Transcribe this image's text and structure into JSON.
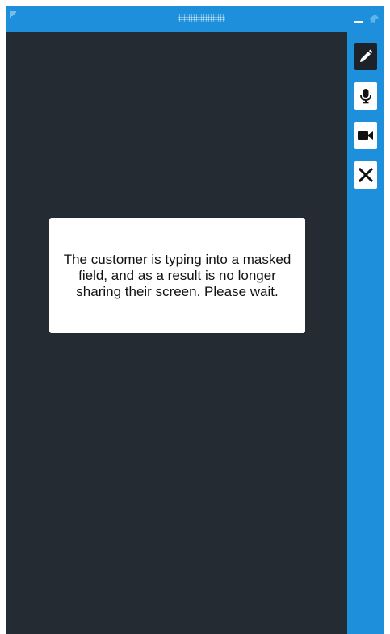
{
  "titlebar": {
    "controls": {
      "resize": "resize-grip-icon",
      "drag": "drag-grip-icon",
      "minimize": "minimize-icon",
      "pin": "pin-icon"
    }
  },
  "toolbar": {
    "buttons": [
      {
        "icon": "pencil-icon",
        "active": true
      },
      {
        "icon": "microphone-icon",
        "active": false
      },
      {
        "icon": "video-camera-icon",
        "active": false
      },
      {
        "icon": "close-icon",
        "active": false
      }
    ]
  },
  "message": {
    "text": "The customer is typing into a masked field, and as a result is no longer sharing their screen. Please wait."
  },
  "colors": {
    "accent": "#1e90db",
    "viewer_bg": "#252b33",
    "active_button": "#1d222a"
  }
}
